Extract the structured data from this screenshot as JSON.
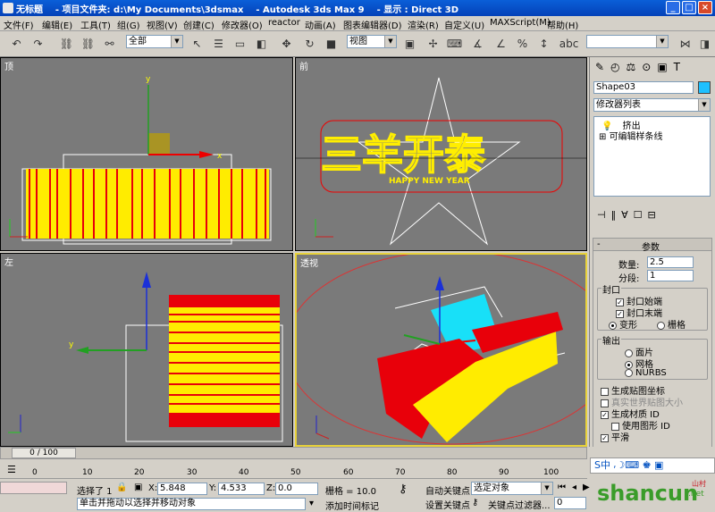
{
  "window": {
    "title": "无标题    - 项目文件夹: d:\\My Documents\\3dsmax    - Autodesk 3ds Max 9    - 显示 : Direct 3D",
    "min": "_",
    "max": "□",
    "close": "×"
  },
  "menu": [
    "文件(F)",
    "编辑(E)",
    "工具(T)",
    "组(G)",
    "视图(V)",
    "创建(C)",
    "修改器(O)",
    "reactor",
    "动画(A)",
    "图表编辑器(D)",
    "渲染(R)",
    "自定义(U)",
    "MAXScript(M)",
    "帮助(H)"
  ],
  "toolbar": {
    "selection_filter": "全部",
    "ref_coord": "视图",
    "named_sel": ""
  },
  "viewports": {
    "top": "顶",
    "front": "前",
    "left": "左",
    "perspective": "透视"
  },
  "viewport_text": {
    "title": "三羊开泰",
    "subtitle": "HAPPY  NEW  YEAR"
  },
  "command_panel": {
    "object_name": "Shape03",
    "object_color": "#1ec0ff",
    "modifier_list": "修改器列表",
    "stack": [
      "挤出",
      "可编辑样条线"
    ],
    "rollout_title": "参数",
    "amount_label": "数量:",
    "amount_value": "2.5",
    "segments_label": "分段:",
    "segments_value": "1",
    "capping_label": "封口",
    "cap_start": "封口始端",
    "cap_end": "封口末端",
    "morph": "变形",
    "grid": "栅格",
    "output_label": "输出",
    "patch": "面片",
    "mesh": "网格",
    "nurbs": "NURBS",
    "gen_map": "生成贴图坐标",
    "real_world": "真实世界贴图大小",
    "gen_matid": "生成材质 ID",
    "use_shape_id": "使用图形 ID",
    "smooth": "平滑"
  },
  "timeline": {
    "frame": "0 / 100",
    "ticks": [
      "0",
      "10",
      "20",
      "30",
      "40",
      "50",
      "60",
      "70",
      "80",
      "90",
      "100"
    ]
  },
  "status": {
    "selected": "选择了 1",
    "x_label": "X:",
    "x": "5.848",
    "y_label": "Y:",
    "y": "4.533",
    "z_label": "Z:",
    "z": "0.0",
    "grid": "栅格 = 10.0",
    "auto_key": "自动关键点",
    "set_key": "设置关键点",
    "sel_object": "选定对象",
    "key_filters": "关键点过滤器...",
    "prompt": "单击并拖动以选择并移动对象",
    "add_time_tag": "添加时间标记",
    "frame_field": "0"
  },
  "watermark": {
    "brand": "shancun",
    "domain": ".net",
    "sub": "山村"
  }
}
